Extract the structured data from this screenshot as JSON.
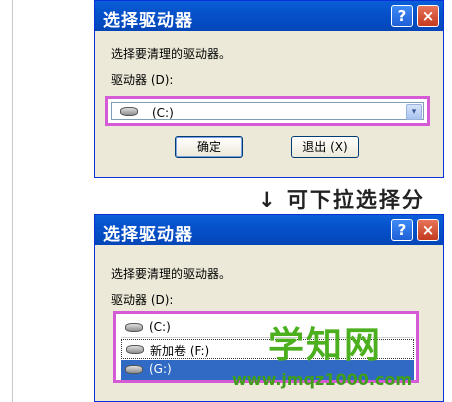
{
  "dialog_top": {
    "title": "选择驱动器",
    "help_glyph": "?",
    "close_glyph": "×",
    "prompt": "选择要清理的驱动器。",
    "drive_label": "驱动器 (D):",
    "selected_drive": "(C:)",
    "dropdown_glyph": "▾",
    "ok_label": "确定",
    "exit_label": "退出 (X)"
  },
  "caption": "↓ 可下拉选择分",
  "dialog_bottom": {
    "title": "选择驱动器",
    "help_glyph": "?",
    "close_glyph": "×",
    "prompt": "选择要清理的驱动器。",
    "drive_label": "驱动器 (D):",
    "options": [
      {
        "label": "(C:)",
        "state": "normal"
      },
      {
        "label": "新加卷 (F:)",
        "state": "focused"
      },
      {
        "label": "(G:)",
        "state": "selected"
      }
    ]
  },
  "watermark": {
    "logo": "学知网",
    "url": "www.jmqz1000.com"
  },
  "colors": {
    "title_bar": "#0550c9",
    "dialog_bg": "#ece9d8",
    "highlight_frame": "#d45ad6",
    "selection": "#316ac5",
    "watermark": "#4caf1e"
  }
}
